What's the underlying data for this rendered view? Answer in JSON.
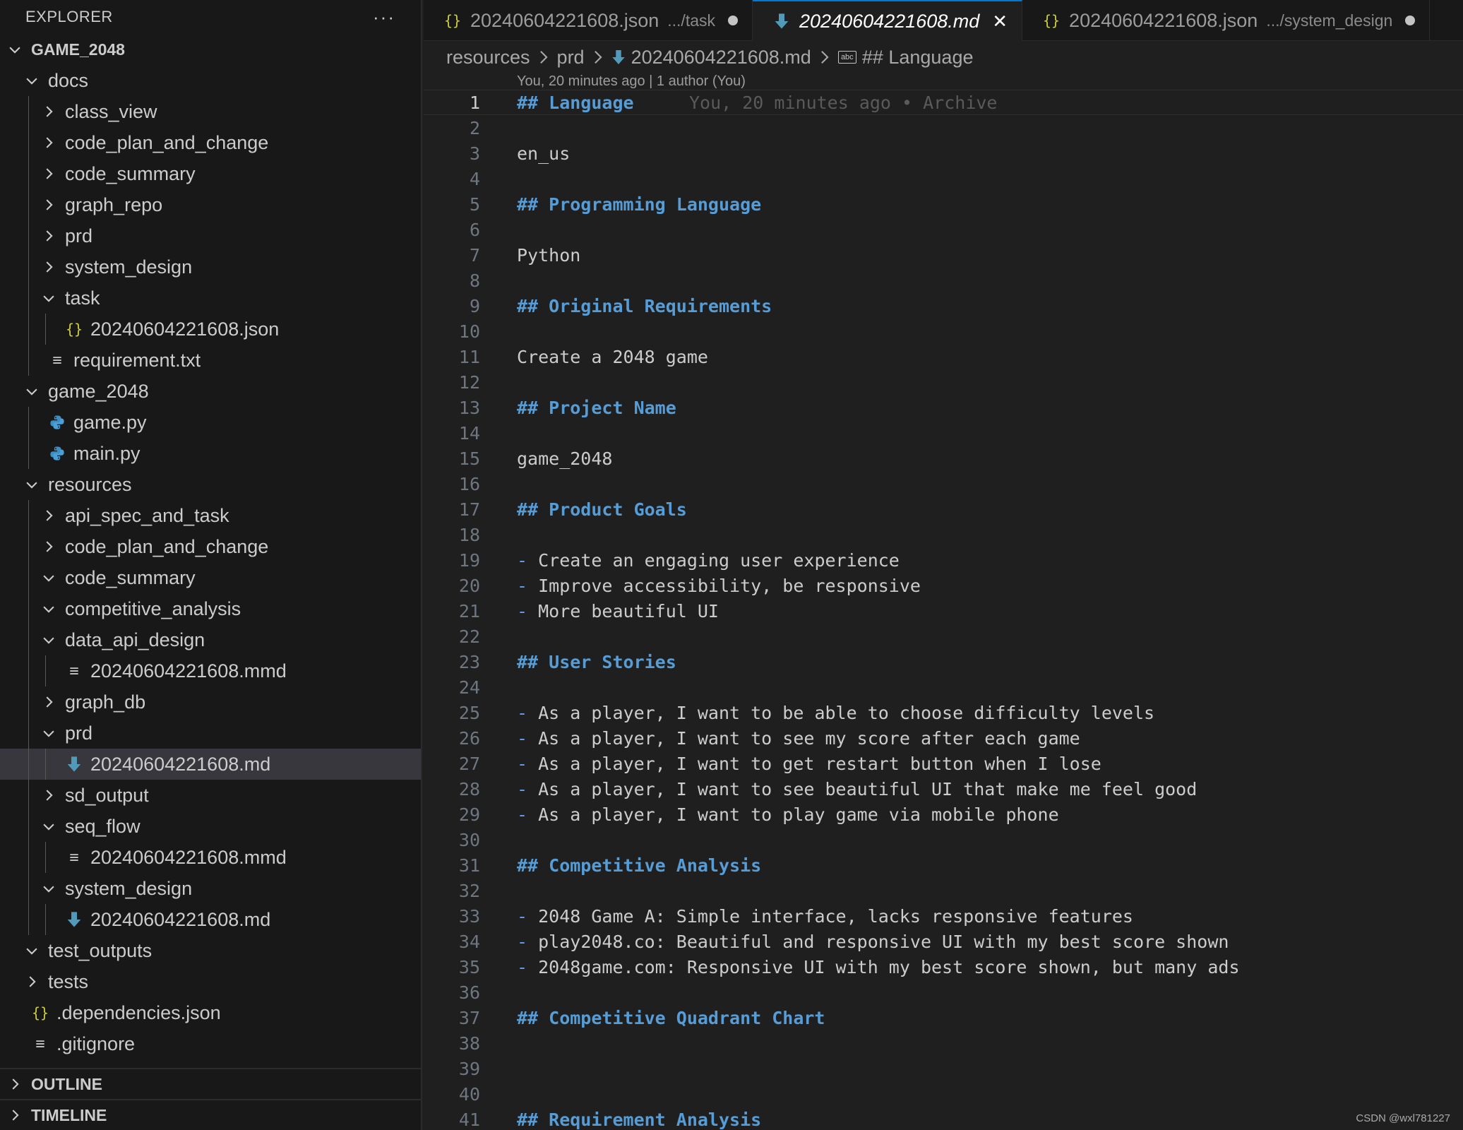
{
  "sidebar": {
    "title": "EXPLORER",
    "more_label": "···",
    "tree": [
      {
        "label": "GAME_2048",
        "kind": "folder",
        "expanded": true,
        "depth": 0,
        "root": true
      },
      {
        "label": "docs",
        "kind": "folder",
        "expanded": true,
        "depth": 1
      },
      {
        "label": "class_view",
        "kind": "folder",
        "expanded": false,
        "depth": 2
      },
      {
        "label": "code_plan_and_change",
        "kind": "folder",
        "expanded": false,
        "depth": 2
      },
      {
        "label": "code_summary",
        "kind": "folder",
        "expanded": false,
        "depth": 2
      },
      {
        "label": "graph_repo",
        "kind": "folder",
        "expanded": false,
        "depth": 2
      },
      {
        "label": "prd",
        "kind": "folder",
        "expanded": false,
        "depth": 2
      },
      {
        "label": "system_design",
        "kind": "folder",
        "expanded": false,
        "depth": 2
      },
      {
        "label": "task",
        "kind": "folder",
        "expanded": true,
        "depth": 2
      },
      {
        "label": "20240604221608.json",
        "kind": "json",
        "depth": 3
      },
      {
        "label": "requirement.txt",
        "kind": "text",
        "depth": 2
      },
      {
        "label": "game_2048",
        "kind": "folder",
        "expanded": true,
        "depth": 1
      },
      {
        "label": "game.py",
        "kind": "python",
        "depth": 2
      },
      {
        "label": "main.py",
        "kind": "python",
        "depth": 2
      },
      {
        "label": "resources",
        "kind": "folder",
        "expanded": true,
        "depth": 1
      },
      {
        "label": "api_spec_and_task",
        "kind": "folder",
        "expanded": false,
        "depth": 2
      },
      {
        "label": "code_plan_and_change",
        "kind": "folder",
        "expanded": false,
        "depth": 2
      },
      {
        "label": "code_summary",
        "kind": "folder",
        "expanded": true,
        "depth": 2
      },
      {
        "label": "competitive_analysis",
        "kind": "folder",
        "expanded": true,
        "depth": 2
      },
      {
        "label": "data_api_design",
        "kind": "folder",
        "expanded": true,
        "depth": 2
      },
      {
        "label": "20240604221608.mmd",
        "kind": "text",
        "depth": 3
      },
      {
        "label": "graph_db",
        "kind": "folder",
        "expanded": false,
        "depth": 2
      },
      {
        "label": "prd",
        "kind": "folder",
        "expanded": true,
        "depth": 2
      },
      {
        "label": "20240604221608.md",
        "kind": "markdown",
        "depth": 3,
        "selected": true
      },
      {
        "label": "sd_output",
        "kind": "folder",
        "expanded": false,
        "depth": 2
      },
      {
        "label": "seq_flow",
        "kind": "folder",
        "expanded": true,
        "depth": 2
      },
      {
        "label": "20240604221608.mmd",
        "kind": "text",
        "depth": 3
      },
      {
        "label": "system_design",
        "kind": "folder",
        "expanded": true,
        "depth": 2
      },
      {
        "label": "20240604221608.md",
        "kind": "markdown",
        "depth": 3
      },
      {
        "label": "test_outputs",
        "kind": "folder",
        "expanded": true,
        "depth": 1
      },
      {
        "label": "tests",
        "kind": "folder",
        "expanded": false,
        "depth": 1
      },
      {
        "label": ".dependencies.json",
        "kind": "json",
        "depth": 1
      },
      {
        "label": ".gitignore",
        "kind": "text",
        "depth": 1
      }
    ],
    "panels": {
      "outline": "OUTLINE",
      "timeline": "TIMELINE"
    }
  },
  "tabs": [
    {
      "label": "20240604221608.json",
      "description": ".../task",
      "kind": "json",
      "active": false,
      "modified": true
    },
    {
      "label": "20240604221608.md",
      "description": "",
      "kind": "markdown",
      "active": true,
      "modified": false
    },
    {
      "label": "20240604221608.json",
      "description": ".../system_design",
      "kind": "json",
      "active": false,
      "modified": true
    }
  ],
  "breadcrumbs": {
    "items": [
      "resources",
      "prd",
      "20240604221608.md",
      "## Language"
    ]
  },
  "editor": {
    "blame_header": "You, 20 minutes ago | 1 author (You)",
    "inline_blame": "You, 20 minutes ago • Archive",
    "current_line": 1,
    "lines": [
      {
        "n": "1",
        "text": "## Language",
        "type": "heading"
      },
      {
        "n": "2",
        "text": "",
        "type": "text"
      },
      {
        "n": "3",
        "text": "en_us",
        "type": "text"
      },
      {
        "n": "4",
        "text": "",
        "type": "text"
      },
      {
        "n": "5",
        "text": "## Programming Language",
        "type": "heading"
      },
      {
        "n": "6",
        "text": "",
        "type": "text"
      },
      {
        "n": "7",
        "text": "Python",
        "type": "text"
      },
      {
        "n": "8",
        "text": "",
        "type": "text"
      },
      {
        "n": "9",
        "text": "## Original Requirements",
        "type": "heading"
      },
      {
        "n": "10",
        "text": "",
        "type": "text"
      },
      {
        "n": "11",
        "text": "Create a 2048 game",
        "type": "text"
      },
      {
        "n": "12",
        "text": "",
        "type": "text"
      },
      {
        "n": "13",
        "text": "## Project Name",
        "type": "heading"
      },
      {
        "n": "14",
        "text": "",
        "type": "text"
      },
      {
        "n": "15",
        "text": "game_2048",
        "type": "text"
      },
      {
        "n": "16",
        "text": "",
        "type": "text"
      },
      {
        "n": "17",
        "text": "## Product Goals",
        "type": "heading"
      },
      {
        "n": "18",
        "text": "",
        "type": "text"
      },
      {
        "n": "19",
        "text": "Create an engaging user experience",
        "type": "bullet"
      },
      {
        "n": "20",
        "text": "Improve accessibility, be responsive",
        "type": "bullet"
      },
      {
        "n": "21",
        "text": "More beautiful UI",
        "type": "bullet"
      },
      {
        "n": "22",
        "text": "",
        "type": "text"
      },
      {
        "n": "23",
        "text": "## User Stories",
        "type": "heading"
      },
      {
        "n": "24",
        "text": "",
        "type": "text"
      },
      {
        "n": "25",
        "text": "As a player, I want to be able to choose difficulty levels",
        "type": "bullet"
      },
      {
        "n": "26",
        "text": "As a player, I want to see my score after each game",
        "type": "bullet"
      },
      {
        "n": "27",
        "text": "As a player, I want to get restart button when I lose",
        "type": "bullet"
      },
      {
        "n": "28",
        "text": "As a player, I want to see beautiful UI that make me feel good",
        "type": "bullet"
      },
      {
        "n": "29",
        "text": "As a player, I want to play game via mobile phone",
        "type": "bullet"
      },
      {
        "n": "30",
        "text": "",
        "type": "text"
      },
      {
        "n": "31",
        "text": "## Competitive Analysis",
        "type": "heading"
      },
      {
        "n": "32",
        "text": "",
        "type": "text"
      },
      {
        "n": "33",
        "text": "2048 Game A: Simple interface, lacks responsive features",
        "type": "bullet"
      },
      {
        "n": "34",
        "text": "play2048.co: Beautiful and responsive UI with my best score shown",
        "type": "bullet"
      },
      {
        "n": "35",
        "text": "2048game.com: Responsive UI with my best score shown, but many ads",
        "type": "bullet"
      },
      {
        "n": "36",
        "text": "",
        "type": "text"
      },
      {
        "n": "37",
        "text": "## Competitive Quadrant Chart",
        "type": "heading"
      },
      {
        "n": "38",
        "text": "",
        "type": "text"
      },
      {
        "n": "39",
        "text": "",
        "type": "text"
      },
      {
        "n": "40",
        "text": "",
        "type": "text"
      },
      {
        "n": "41",
        "text": "## Requirement Analysis",
        "type": "heading"
      }
    ]
  },
  "watermark": "CSDN @wxl781227",
  "colors": {
    "heading": "#569cd6",
    "bullet": "#6796e6",
    "json_icon": "#cbcb41",
    "markdown_icon": "#519aba",
    "python_icon": "#3b8fc7",
    "accent": "#0078d4"
  }
}
